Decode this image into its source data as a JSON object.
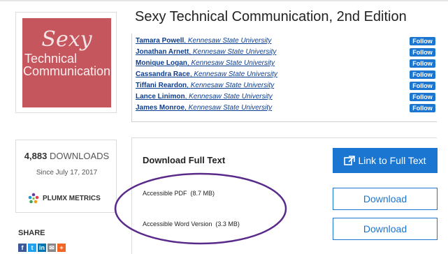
{
  "cover": {
    "line1": "Sexy",
    "line2": "Technical",
    "line3": "Communication"
  },
  "title": "Sexy Technical Communication, 2nd Edition",
  "authors": [
    {
      "name": "Tamara Powell",
      "institution": "Kennesaw State University",
      "follow": "Follow"
    },
    {
      "name": "Jonathan Arnett",
      "institution": "Kennesaw State University",
      "follow": "Follow"
    },
    {
      "name": "Monique Logan",
      "institution": "Kennesaw State University",
      "follow": "Follow"
    },
    {
      "name": "Cassandra Race",
      "institution": "Kennesaw State University",
      "follow": "Follow"
    },
    {
      "name": "Tiffani Reardon",
      "institution": "Kennesaw State University",
      "follow": "Follow"
    },
    {
      "name": "Lance Linimon",
      "institution": "Kennesaw State University",
      "follow": "Follow"
    },
    {
      "name": "James Monroe",
      "institution": "Kennesaw State University",
      "follow": "Follow"
    }
  ],
  "stats": {
    "count": "4,883",
    "label": "DOWNLOADS",
    "since": "Since July 17, 2017",
    "plumx": "PLUMX METRICS"
  },
  "share": {
    "label": "SHARE",
    "icons": [
      "facebook-icon",
      "twitter-icon",
      "linkedin-icon",
      "email-icon",
      "more-icon"
    ]
  },
  "download": {
    "heading": "Download Full Text",
    "link_button": "Link to Full Text",
    "files": [
      {
        "label": "Accessible PDF",
        "size": "(8.7 MB)",
        "button": "Download"
      },
      {
        "label": "Accessible Word Version",
        "size": "(3.3 MB)",
        "button": "Download"
      }
    ]
  },
  "colors": {
    "accent": "#1b76d2",
    "link": "#0b3d91",
    "cover": "#c6565e",
    "annotation": "#5a2a8a"
  }
}
